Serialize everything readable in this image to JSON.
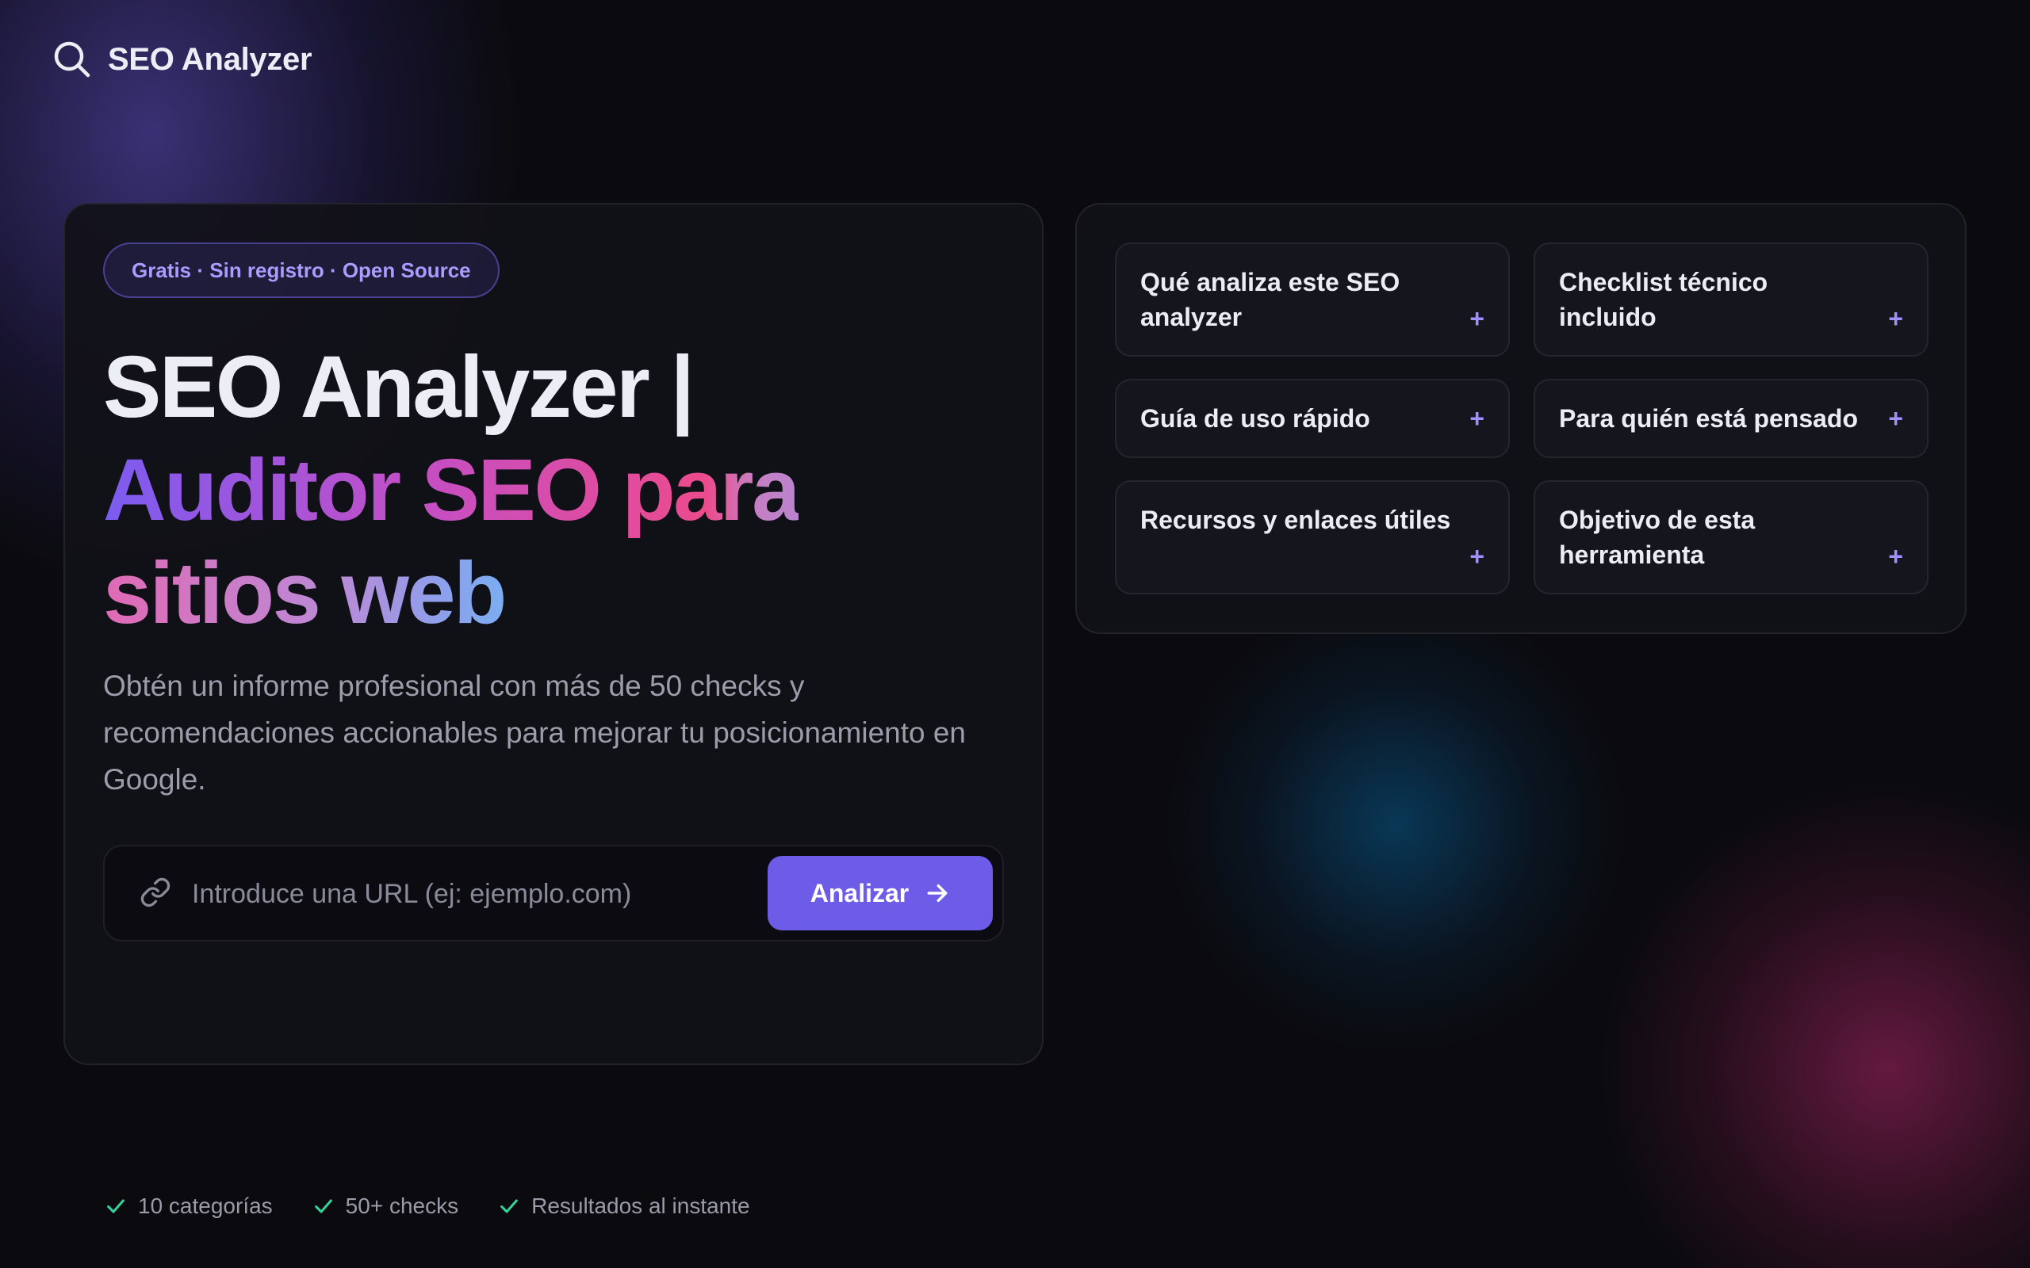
{
  "brand": {
    "name": "SEO Analyzer",
    "icon": "search-icon"
  },
  "hero": {
    "badge": "Gratis · Sin registro · Open Source",
    "title_line1": "SEO Analyzer |",
    "title_line2": "Auditor SEO para",
    "title_line3": "sitios web",
    "description": "Obtén un informe profesional con más de 50 checks y recomendaciones accionables para mejorar tu posicionamiento en Google.",
    "url_input": {
      "placeholder": "Introduce una URL (ej: ejemplo.com)",
      "value": "",
      "icon": "link-icon"
    },
    "analyze_button": {
      "label": "Analizar",
      "icon": "arrow-right-icon"
    },
    "features": [
      {
        "label": "10 categorías",
        "icon": "check-icon"
      },
      {
        "label": "50+ checks",
        "icon": "check-icon"
      },
      {
        "label": "Resultados al instante",
        "icon": "check-icon"
      }
    ]
  },
  "faq": {
    "items": [
      {
        "question": "Qué analiza este SEO analyzer",
        "icon": "plus"
      },
      {
        "question": "Checklist técnico incluido",
        "icon": "plus"
      },
      {
        "question": "Guía de uso rápido",
        "icon": "plus"
      },
      {
        "question": "Para quién está pensado",
        "icon": "plus"
      },
      {
        "question": "Recursos y enlaces útiles",
        "icon": "plus"
      },
      {
        "question": "Objetivo de esta herramienta",
        "icon": "plus"
      }
    ],
    "expand_symbol": "+"
  },
  "colors": {
    "background": "#0b0b0f",
    "accent": "#6c5ce7",
    "badge_text": "#a99cff",
    "check": "#34d399",
    "plus": "#9f8fff"
  }
}
